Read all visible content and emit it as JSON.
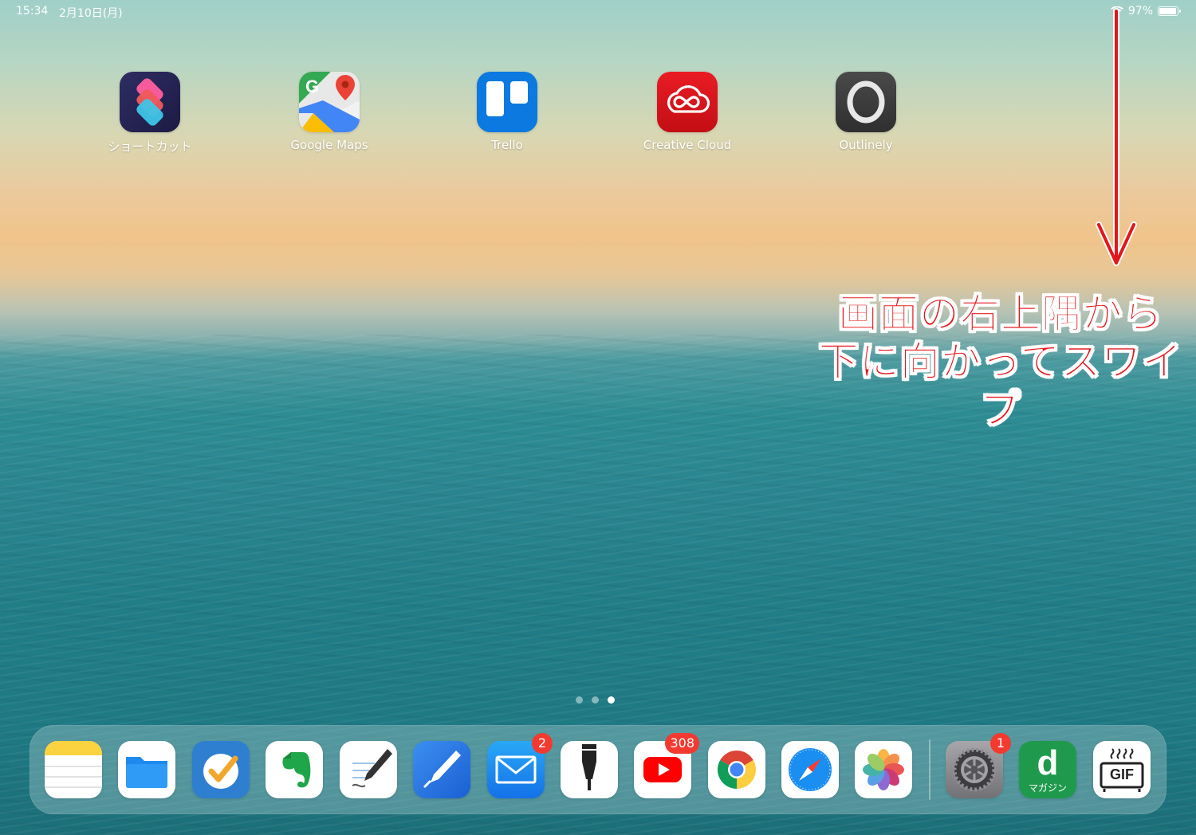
{
  "status_bar": {
    "time": "15:34",
    "date": "2月10日(月)",
    "battery": "97%",
    "battery_level": 0.97
  },
  "home_apps": [
    {
      "label": "ショートカット",
      "icon": "shortcuts-icon"
    },
    {
      "label": "Google Maps",
      "icon": "google-maps-icon"
    },
    {
      "label": "Trello",
      "icon": "trello-icon"
    },
    {
      "label": "Creative Cloud",
      "icon": "creative-cloud-icon"
    },
    {
      "label": "Outlinely",
      "icon": "outlinely-icon"
    }
  ],
  "annotation": {
    "line1": "画面の右上隅から",
    "line2": "下に向かってスワイプ",
    "color": "#e3161b"
  },
  "page_indicator": {
    "count": 3,
    "active": 3
  },
  "dock": {
    "apps": [
      {
        "icon": "notes-icon"
      },
      {
        "icon": "files-icon"
      },
      {
        "icon": "omnifocus-icon"
      },
      {
        "icon": "evernote-icon"
      },
      {
        "icon": "goodnotes-icon"
      },
      {
        "icon": "pen-app-icon"
      },
      {
        "icon": "mail-icon",
        "badge": "2"
      },
      {
        "icon": "technical-pen-icon"
      },
      {
        "icon": "youtube-icon",
        "badge": "308"
      },
      {
        "icon": "chrome-icon"
      },
      {
        "icon": "safari-icon"
      },
      {
        "icon": "photos-icon"
      },
      {
        "icon": "settings-icon",
        "badge": "1"
      },
      {
        "icon": "d-magazine-icon",
        "label": "マガジン"
      },
      {
        "icon": "gif-maker-icon",
        "label": "GIF"
      }
    ]
  }
}
